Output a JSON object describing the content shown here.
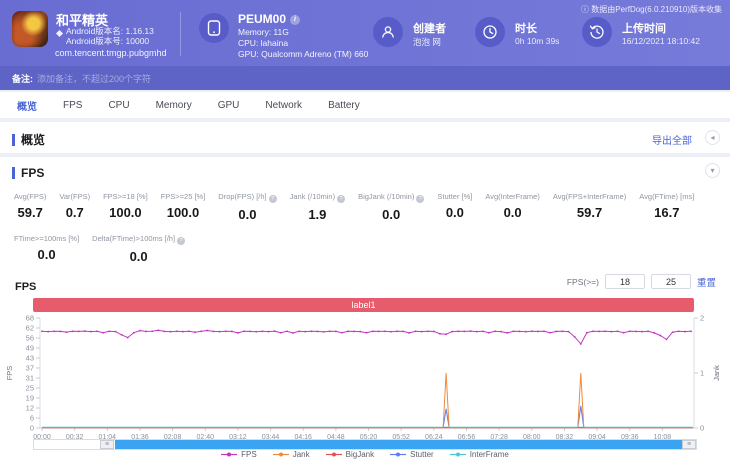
{
  "header": {
    "app": {
      "name": "和平精英",
      "version_name": "Android版本名: 1.16.13",
      "version_code": "Android版本号: 10000",
      "package": "com.tencent.tmgp.pubgmhd"
    },
    "device": {
      "name": "PEUM00",
      "memory": "Memory: 11G",
      "cpu": "CPU: lahaina",
      "gpu": "GPU: Qualcomm Adreno (TM) 660"
    },
    "creator": {
      "label": "创建者",
      "value": "泡泡 网"
    },
    "duration": {
      "label": "时长",
      "value": "0h 10m 39s"
    },
    "upload": {
      "label": "上传时间",
      "value": "16/12/2021 18:10:42"
    },
    "source_note": {
      "icon": "ⓘ",
      "text": "数据由PerfDog(6.0.210910)版本收集"
    },
    "note": {
      "label": "备注:",
      "placeholder": "添加备注，不超过200个字符"
    }
  },
  "tabs": [
    {
      "label": "概览",
      "active": true
    },
    {
      "label": "FPS",
      "active": false
    },
    {
      "label": "CPU",
      "active": false
    },
    {
      "label": "Memory",
      "active": false
    },
    {
      "label": "GPU",
      "active": false
    },
    {
      "label": "Network",
      "active": false
    },
    {
      "label": "Battery",
      "active": false
    }
  ],
  "overview": {
    "title": "概览",
    "export_label": "导出全部"
  },
  "fps_section": {
    "title": "FPS",
    "metrics_row1": [
      {
        "label": "Avg(FPS)",
        "value": "59.7"
      },
      {
        "label": "Var(FPS)",
        "value": "0.7"
      },
      {
        "label": "FPS>=18 [%]",
        "value": "100.0"
      },
      {
        "label": "FPS>=25 [%]",
        "value": "100.0"
      },
      {
        "label": "Drop(FPS) [/h]",
        "value": "0.0",
        "info": true
      },
      {
        "label": "Jank (/10min)",
        "value": "1.9",
        "info": true
      },
      {
        "label": "BigJank (/10min)",
        "value": "0.0",
        "info": true
      },
      {
        "label": "Stutter [%]",
        "value": "0.0"
      },
      {
        "label": "Avg(InterFrame)",
        "value": "0.0"
      },
      {
        "label": "Avg(FPS+InterFrame)",
        "value": "59.7"
      },
      {
        "label": "Avg(FTime) [ms]",
        "value": "16.7"
      }
    ],
    "metrics_row2": [
      {
        "label": "FTime>=100ms [%]",
        "value": "0.0"
      },
      {
        "label": "Delta(FTime)>100ms [/h]",
        "value": "0.0",
        "info": true
      }
    ],
    "threshold": {
      "label": "FPS(>=)",
      "low": "18",
      "high": "25",
      "reset_label": "重置"
    }
  },
  "icons": {
    "collapse_overview": "◂",
    "collapse_fps": "▾",
    "scroll_handle": "≡",
    "metric_info": "?",
    "device_info": "i"
  },
  "chart_data": {
    "type": "line",
    "title": "FPS",
    "annotation_bar": {
      "label": "label1",
      "color": "#e75c6d"
    },
    "x_axis": {
      "tick_interval_s": 32,
      "duration_s": 638,
      "ticks": [
        "00:00",
        "00:32",
        "01:04",
        "01:36",
        "02:08",
        "02:40",
        "03:12",
        "03:44",
        "04:16",
        "04:48",
        "05:20",
        "05:52",
        "06:24",
        "06:56",
        "07:28",
        "08:00",
        "08:32",
        "09:04",
        "09:36",
        "10:08"
      ]
    },
    "y_left": {
      "label": "FPS",
      "ticks": [
        0,
        6,
        12,
        19,
        25,
        31,
        37,
        43,
        49,
        56,
        62,
        68
      ],
      "max": 68
    },
    "y_right": {
      "label": "Jank",
      "ticks": [
        0,
        1,
        2
      ],
      "max": 2
    },
    "legend_position": "bottom",
    "grid": false,
    "series": [
      {
        "name": "InterFrame",
        "color": "#49c9d6",
        "axis": "left",
        "baseline": 0,
        "spikes": []
      },
      {
        "name": "BigJank",
        "color": "#e25050",
        "axis": "right",
        "baseline": 0,
        "spikes": []
      },
      {
        "name": "Stutter",
        "color": "#5b7ff0",
        "axis": "right",
        "baseline": 0,
        "spikes": [
          {
            "t": 396,
            "v": 0.35
          },
          {
            "t": 528,
            "v": 0.4
          }
        ]
      },
      {
        "name": "Jank",
        "color": "#ef8a3c",
        "axis": "right",
        "baseline": 0,
        "spikes": [
          {
            "t": 396,
            "v": 1
          },
          {
            "t": 528,
            "v": 1
          }
        ]
      },
      {
        "name": "FPS",
        "color": "#c136c1",
        "axis": "left",
        "t_step_s": 6,
        "values": [
          59.8,
          59.6,
          59.8,
          59.7,
          59.3,
          59.8,
          59.7,
          59.9,
          59.6,
          59.8,
          58.9,
          59.8,
          59.6,
          57.6,
          55.9,
          58.9,
          60.2,
          59.7,
          59.8,
          60.4,
          59.7,
          59.5,
          59.8,
          59.6,
          59.8,
          59.2,
          59.8,
          60.3,
          59.7,
          59.6,
          59.8,
          59.7,
          58.8,
          59.8,
          59.7,
          59.5,
          59.8,
          59.6,
          59.9,
          58.9,
          59.8,
          58.7,
          59.8,
          59.6,
          59.8,
          59.7,
          59.4,
          59.8,
          59.7,
          58.9,
          59.8,
          59.7,
          59.6,
          58.9,
          59.8,
          59.7,
          59.8,
          59.5,
          59.8,
          59.7,
          58.8,
          59.8,
          59.6,
          59.8,
          59.7,
          58.3,
          58.0,
          59.6,
          59.8,
          59.7,
          59.9,
          59.6,
          59.8,
          58.9,
          59.8,
          59.6,
          58.8,
          59.8,
          59.7,
          59.5,
          59.8,
          59.7,
          59.8,
          58.9,
          59.7,
          59.8,
          59.6,
          56.4,
          52.0,
          58.9,
          59.8,
          59.7,
          59.8,
          59.6,
          59.8,
          58.9,
          59.8,
          59.7,
          59.6,
          59.8,
          58.8,
          57.2,
          54.8,
          59.2,
          59.8,
          59.6,
          59.8
        ]
      }
    ],
    "legend_order": [
      "FPS",
      "Jank",
      "BigJank",
      "Stutter",
      "InterFrame"
    ]
  }
}
